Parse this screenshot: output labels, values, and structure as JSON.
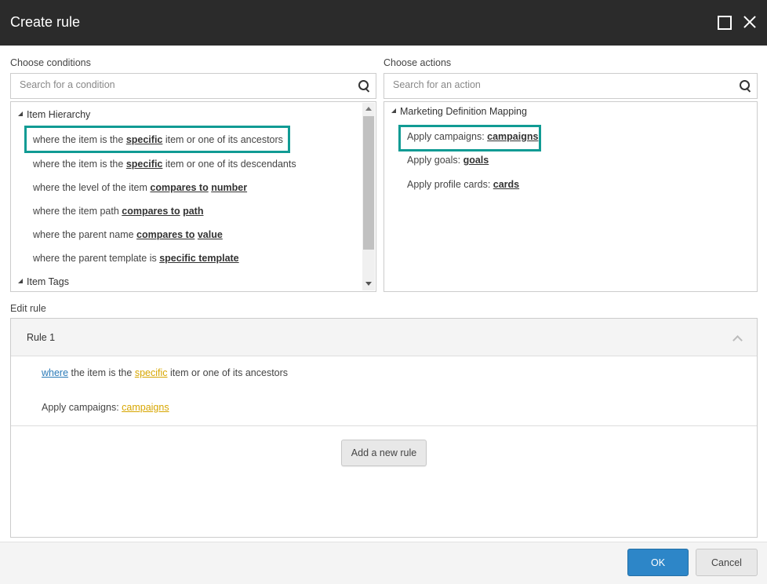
{
  "window": {
    "title": "Create rule"
  },
  "conditions": {
    "label": "Choose conditions",
    "search_placeholder": "Search for a condition",
    "groups": [
      {
        "name": "Item Hierarchy",
        "items": [
          {
            "parts": [
              "where the item is the ",
              "specific",
              " item or one of its ancestors"
            ]
          },
          {
            "parts": [
              "where the item is the ",
              "specific",
              " item or one of its descendants"
            ]
          },
          {
            "parts": [
              "where the level of the item ",
              "compares to",
              " ",
              "number"
            ]
          },
          {
            "parts": [
              "where the item path ",
              "compares to",
              " ",
              "path"
            ]
          },
          {
            "parts": [
              "where the parent name ",
              "compares to",
              " ",
              "value"
            ]
          },
          {
            "parts": [
              "where the parent template is ",
              "specific template"
            ]
          }
        ]
      },
      {
        "name": "Item Tags",
        "items": []
      }
    ]
  },
  "actions": {
    "label": "Choose actions",
    "search_placeholder": "Search for an action",
    "groups": [
      {
        "name": "Marketing Definition Mapping",
        "items": [
          {
            "parts": [
              "Apply campaigns: ",
              "campaigns"
            ]
          },
          {
            "parts": [
              "Apply goals: ",
              "goals"
            ]
          },
          {
            "parts": [
              "Apply profile cards: ",
              "cards"
            ]
          }
        ]
      }
    ]
  },
  "edit_rule": {
    "label": "Edit rule",
    "rule_title": "Rule 1",
    "condition_line": [
      "where",
      " the item is the ",
      "specific",
      " item or one of its ancestors"
    ],
    "action_line": [
      "Apply campaigns: ",
      "campaigns"
    ],
    "add_rule_label": "Add a new rule"
  },
  "footer": {
    "ok_label": "OK",
    "cancel_label": "Cancel"
  },
  "colors": {
    "titlebar": "#2b2b2b",
    "highlight": "#119b94",
    "ok_button": "#2d86c8",
    "link_blue": "#2a7ab8",
    "link_yellow": "#d7a600"
  },
  "icons": [
    "maximize-icon",
    "close-icon",
    "search-icon",
    "triangle-expanded-icon",
    "chevron-up-icon",
    "scroll-up-icon",
    "scroll-down-icon"
  ]
}
